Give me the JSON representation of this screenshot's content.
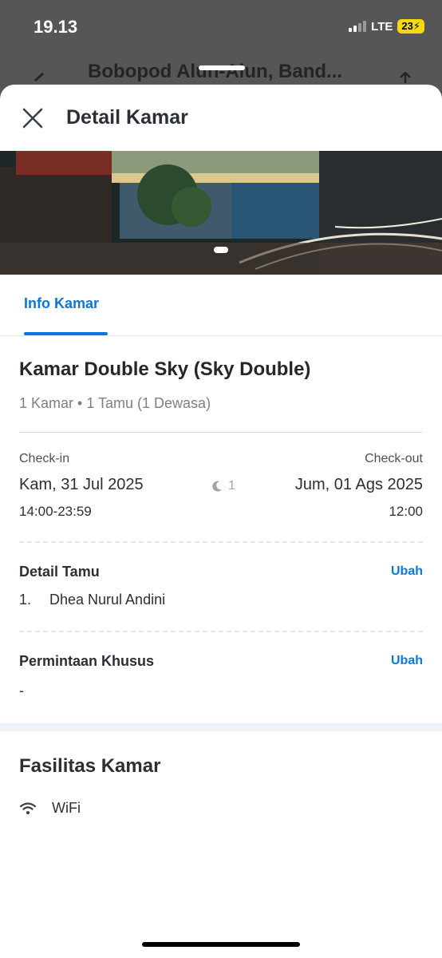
{
  "status_bar": {
    "time": "19.13",
    "network": "LTE",
    "battery": "23"
  },
  "background_page": {
    "title": "Bobopod Alun-Alun, Band..."
  },
  "sheet": {
    "title": "Detail Kamar"
  },
  "tabs": [
    {
      "label": "Info Kamar",
      "active": true
    }
  ],
  "room": {
    "name": "Kamar Double Sky (Sky Double)",
    "summary": "1 Kamar • 1 Tamu (1 Dewasa)"
  },
  "stay": {
    "checkin_label": "Check-in",
    "checkout_label": "Check-out",
    "checkin_date": "Kam, 31 Jul 2025",
    "checkout_date": "Jum, 01 Ags 2025",
    "checkin_time": "14:00-23:59",
    "checkout_time": "12:00",
    "nights": "1"
  },
  "guest_details": {
    "title": "Detail Tamu",
    "action": "Ubah",
    "guests": [
      {
        "number": "1.",
        "name": "Dhea Nurul Andini"
      }
    ]
  },
  "special_request": {
    "title": "Permintaan Khusus",
    "action": "Ubah",
    "value": "-"
  },
  "facilities": {
    "title": "Fasilitas Kamar",
    "items": [
      {
        "icon": "wifi-icon",
        "label": "WiFi"
      }
    ]
  },
  "colors": {
    "accent": "#0b76dc",
    "battery": "#f5d90a"
  }
}
